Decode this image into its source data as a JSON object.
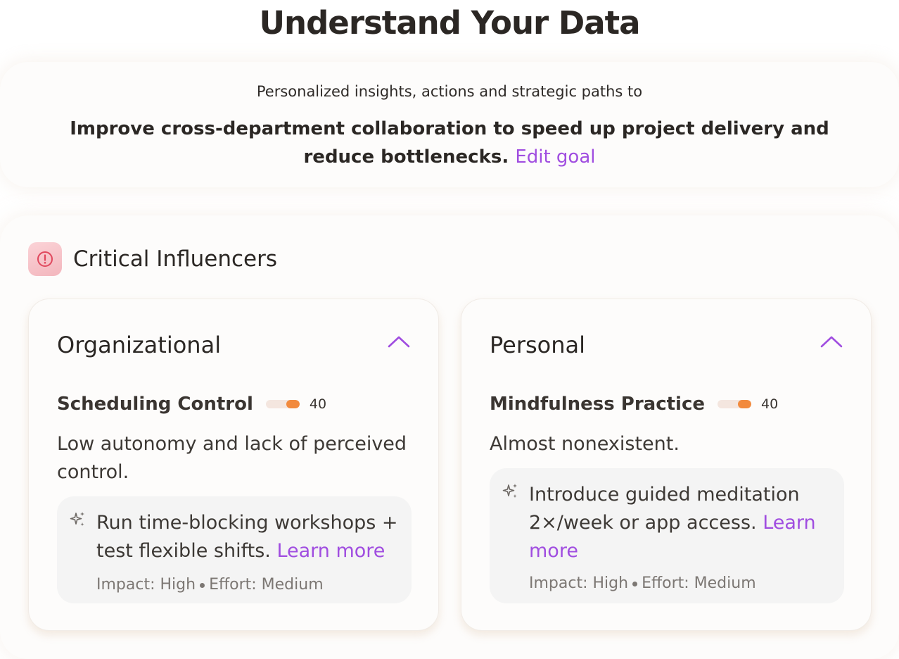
{
  "page": {
    "title": "Understand Your Data"
  },
  "goal": {
    "kicker": "Personalized insights, actions and strategic paths to",
    "text": "Improve cross-department collaboration to speed up project delivery and reduce bottlenecks.",
    "edit_label": "Edit goal"
  },
  "section": {
    "title": "Critical Influencers",
    "icon": "alert-circle-icon"
  },
  "cards": [
    {
      "title": "Organizational",
      "factor": {
        "name": "Scheduling Control",
        "score": "40",
        "level": 0.4
      },
      "description": "Low autonomy and lack of perceived control.",
      "recommendation": {
        "text": "Run time-blocking workshops + test flexible shifts.",
        "link_label": "Learn more",
        "impact": "Impact: High",
        "effort": "Effort: Medium"
      }
    },
    {
      "title": "Personal",
      "factor": {
        "name": "Mindfulness Practice",
        "score": "40",
        "level": 0.4
      },
      "description": "Almost nonexistent.",
      "recommendation": {
        "text": "Introduce guided meditation 2×/week or app access.",
        "link_label": "Learn more",
        "impact": "Impact: High",
        "effort": "Effort: Medium"
      }
    }
  ],
  "colors": {
    "accent": "#a04de0",
    "meter_fill": "#f28a3d",
    "meter_track": "#f4e6df",
    "alert": "#e0475c"
  }
}
